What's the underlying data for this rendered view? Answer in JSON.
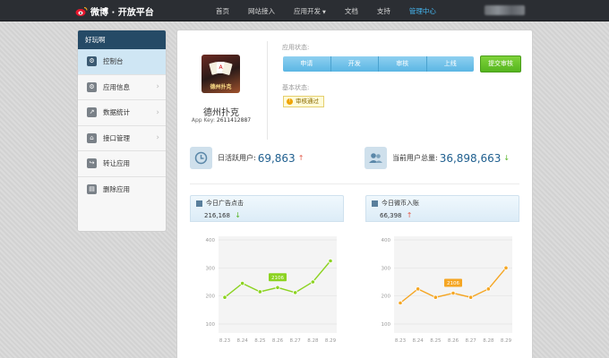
{
  "header": {
    "logo_text": "微博 · 开放平台",
    "nav": [
      {
        "label": "首页",
        "active": false
      },
      {
        "label": "网站接入",
        "active": false
      },
      {
        "label": "应用开发",
        "active": false,
        "dropdown": true
      },
      {
        "label": "文档",
        "active": false
      },
      {
        "label": "支持",
        "active": false
      },
      {
        "label": "管理中心",
        "active": true
      }
    ]
  },
  "sidebar": {
    "title": "好玩啊",
    "items": [
      {
        "label": "控制台",
        "icon": "sliders-icon",
        "active": true
      },
      {
        "label": "应用信息",
        "icon": "gear-icon",
        "active": false
      },
      {
        "label": "数据统计",
        "icon": "chart-icon",
        "active": false
      },
      {
        "label": "接口管理",
        "icon": "plug-icon",
        "active": false
      },
      {
        "label": "转让应用",
        "icon": "share-icon",
        "active": false
      },
      {
        "label": "删除应用",
        "icon": "trash-icon",
        "active": false
      }
    ]
  },
  "app": {
    "name": "德州扑克",
    "icon_caption": "德州扑克",
    "key_label": "App Key:",
    "key_value": "2611412887"
  },
  "status": {
    "app_status_label": "应用状态:",
    "steps": [
      "申请",
      "开发",
      "审核",
      "上线"
    ],
    "submit_label": "提交审核",
    "basic_status_label": "基本状态:",
    "basic_status_value": "审核通过"
  },
  "stats": {
    "daily_active": {
      "label": "日活跃用户:",
      "value": "69,863",
      "trend": "up"
    },
    "total_users": {
      "label": "当前用户总量:",
      "value": "36,898,663",
      "trend": "down"
    }
  },
  "colors": {
    "nav_bg": "#2b2e33",
    "accent_blue": "#45b6f0",
    "green_line": "#8cd321",
    "orange_line": "#f5a623",
    "up": "#e35a4a",
    "down": "#58b52a"
  },
  "chart_data": [
    {
      "type": "line",
      "title": "今日广告点击",
      "subtitle": "216,168",
      "trend": "down",
      "categories": [
        "8.23",
        "8.24",
        "8.25",
        "8.26",
        "8.27",
        "8.28",
        "8.29"
      ],
      "values": [
        195,
        245,
        215,
        230,
        212,
        250,
        325
      ],
      "ylim": [
        100,
        400
      ],
      "yticks": [
        "100",
        "200",
        "300",
        "400"
      ],
      "highlight": {
        "index": 3,
        "label": "2106"
      },
      "color": "#8cd321"
    },
    {
      "type": "line",
      "title": "今日微币入账",
      "subtitle": "66,398",
      "trend": "up",
      "categories": [
        "8.23",
        "8.24",
        "8.25",
        "8.26",
        "8.27",
        "8.28",
        "8.29"
      ],
      "values": [
        175,
        225,
        195,
        210,
        195,
        225,
        300
      ],
      "ylim": [
        100,
        400
      ],
      "yticks": [
        "100",
        "200",
        "300",
        "400"
      ],
      "highlight": {
        "index": 3,
        "label": "2106"
      },
      "color": "#f5a623"
    }
  ]
}
